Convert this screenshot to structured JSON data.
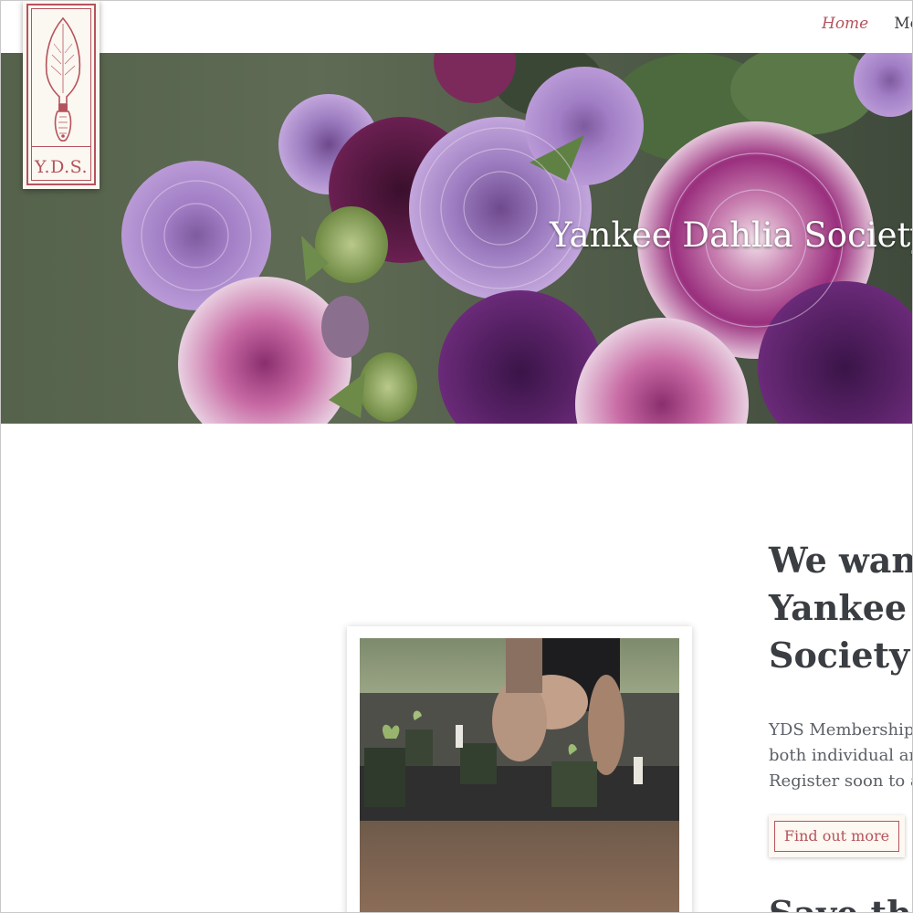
{
  "nav": {
    "items": [
      {
        "label": "Home",
        "active": true
      },
      {
        "label": "Mem"
      }
    ]
  },
  "logo": {
    "text": "Y.D.S.",
    "icon": "trowel-icon"
  },
  "hero": {
    "title": "Yankee Dahlia Society"
  },
  "main": {
    "heading_bold": "We want",
    "heading_line2": "Yankee D",
    "heading_line3": "Society!",
    "paragraph_lines": [
      "YDS Membership",
      "both individual an",
      "Register soon to at"
    ],
    "button_label": "Find out more",
    "heading2": "Save the"
  },
  "colors": {
    "accent": "#b5535d",
    "text": "#3a3d42",
    "cream": "#fbf7f1"
  }
}
